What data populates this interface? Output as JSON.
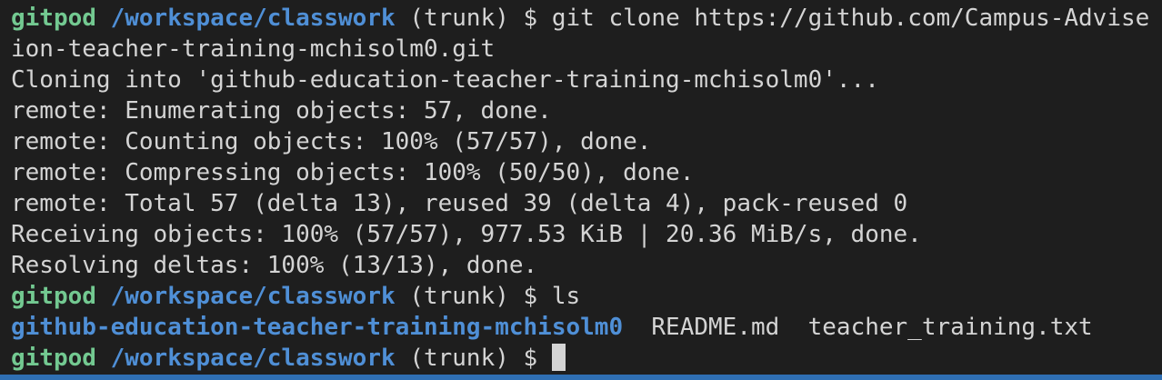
{
  "prompt": {
    "user": "gitpod",
    "path": "/workspace/classwork",
    "branch": "(trunk)",
    "symbol": "$"
  },
  "lines": {
    "l1_cmd": " git clone https://github.com/Campus-Advise",
    "l2": "ion-teacher-training-mchisolm0.git",
    "l3": "Cloning into 'github-education-teacher-training-mchisolm0'...",
    "l4": "remote: Enumerating objects: 57, done.",
    "l5": "remote: Counting objects: 100% (57/57), done.",
    "l6": "remote: Compressing objects: 100% (50/50), done.",
    "l7": "remote: Total 57 (delta 13), reused 39 (delta 4), pack-reused 0",
    "l8": "Receiving objects: 100% (57/57), 977.53 KiB | 20.36 MiB/s, done.",
    "l9": "Resolving deltas: 100% (13/13), done.",
    "l10_cmd": " ls"
  },
  "ls_output": {
    "dir": "github-education-teacher-training-mchisolm0",
    "file1": "README.md",
    "file2": "teacher_training.txt"
  },
  "colors": {
    "background": "#1e1e1e",
    "user": "#73c991",
    "path": "#4f8fd6",
    "text": "#d4d4d4",
    "status_bar": "#2f6fb3"
  }
}
